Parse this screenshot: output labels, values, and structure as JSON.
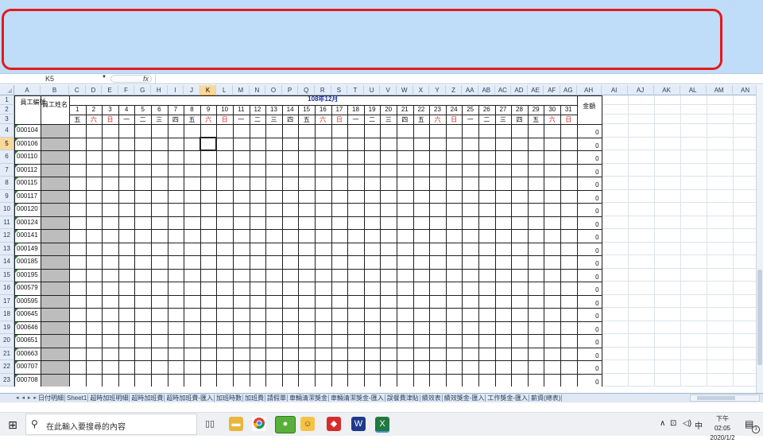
{
  "formula_bar": {
    "name_box": "K5",
    "fx_label": "fx"
  },
  "spreadsheet": {
    "columns": [
      "A",
      "B",
      "C",
      "D",
      "E",
      "F",
      "G",
      "H",
      "I",
      "J",
      "K",
      "L",
      "M",
      "N",
      "O",
      "P",
      "Q",
      "R",
      "S",
      "T",
      "U",
      "V",
      "W",
      "X",
      "Y",
      "Z",
      "AA",
      "AB",
      "AC",
      "AD",
      "AE",
      "AF",
      "AG",
      "AH",
      "AI",
      "AJ",
      "AK",
      "AL",
      "AM",
      "AN"
    ],
    "active_column": "K",
    "active_row": "5",
    "row_numbers": [
      "1",
      "2",
      "3",
      "4",
      "5",
      "6",
      "7",
      "8",
      "9",
      "10",
      "11",
      "12",
      "13",
      "14",
      "15",
      "16",
      "17",
      "18",
      "19",
      "20",
      "21",
      "22",
      "23"
    ],
    "header": {
      "employee_no": "員工編號",
      "employee_name": "員工姓名",
      "month_title": "108年12月",
      "amount": "金額"
    },
    "days": [
      "1",
      "2",
      "3",
      "4",
      "5",
      "6",
      "7",
      "8",
      "9",
      "10",
      "11",
      "12",
      "13",
      "14",
      "15",
      "16",
      "17",
      "18",
      "19",
      "20",
      "21",
      "22",
      "23",
      "24",
      "25",
      "26",
      "27",
      "28",
      "29",
      "30",
      "31"
    ],
    "weekdays": [
      "五",
      "六",
      "日",
      "一",
      "二",
      "三",
      "四",
      "五",
      "六",
      "日",
      "一",
      "二",
      "三",
      "四",
      "五",
      "六",
      "日",
      "一",
      "二",
      "三",
      "四",
      "五",
      "六",
      "日",
      "一",
      "二",
      "三",
      "四",
      "五",
      "六",
      "日"
    ],
    "weekend_color": "#d21f1f",
    "employees": [
      {
        "id": "000104",
        "amount": "0"
      },
      {
        "id": "000106",
        "amount": "0"
      },
      {
        "id": "000110",
        "amount": "0"
      },
      {
        "id": "000112",
        "amount": "0"
      },
      {
        "id": "000115",
        "amount": "0"
      },
      {
        "id": "000117",
        "amount": "0"
      },
      {
        "id": "000120",
        "amount": "0"
      },
      {
        "id": "000124",
        "amount": "0"
      },
      {
        "id": "000141",
        "amount": "0"
      },
      {
        "id": "000149",
        "amount": "0"
      },
      {
        "id": "000185",
        "amount": "0"
      },
      {
        "id": "000195",
        "amount": "0"
      },
      {
        "id": "000579",
        "amount": "0"
      },
      {
        "id": "000595",
        "amount": "0"
      },
      {
        "id": "000645",
        "amount": "0"
      },
      {
        "id": "000646",
        "amount": "0"
      },
      {
        "id": "000651",
        "amount": "0"
      },
      {
        "id": "000663",
        "amount": "0"
      },
      {
        "id": "000707",
        "amount": "0"
      },
      {
        "id": "000708",
        "amount": "0"
      }
    ]
  },
  "sheet_tabs": [
    "日付明細",
    "Sheet1",
    "超時加班明細",
    "超時加班費",
    "超時加班費-匯入",
    "加班時數",
    "加班費",
    "請假單",
    "車輛清潔獎金",
    "車輛清潔獎金-匯入",
    "誤餐費津貼",
    "績效表",
    "績效獎金-匯入",
    "工作獎金-匯入",
    "薪資(總表)"
  ],
  "taskbar": {
    "search_placeholder": "在此輸入要搜尋的內容",
    "ime": "中",
    "time": "下午 02:05",
    "date": "2020/1/2",
    "notification_count": "3",
    "tray_chevron": "∧"
  }
}
